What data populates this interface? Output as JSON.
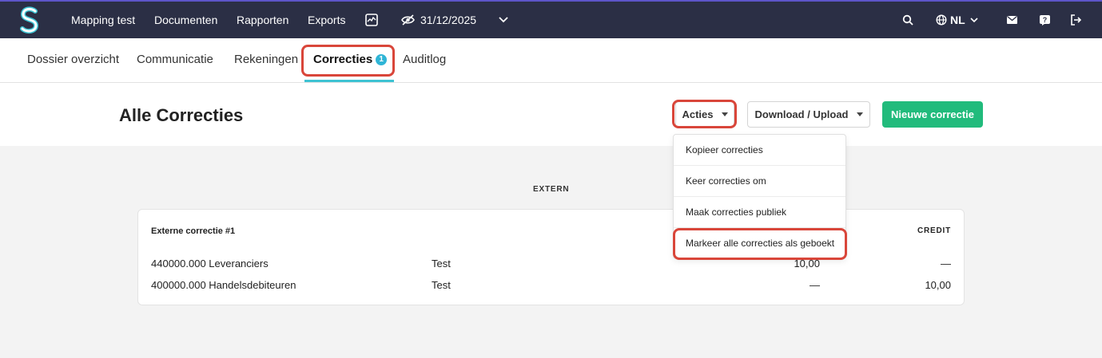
{
  "topbar": {
    "logo": "S",
    "nav": [
      "Mapping test",
      "Documenten",
      "Rapporten",
      "Exports"
    ],
    "date": "31/12/2025",
    "language": "NL",
    "icons": [
      "chart-icon",
      "eye-off-icon",
      "chevron-down-icon",
      "search-icon",
      "globe-icon",
      "mail-icon",
      "help-icon",
      "logout-icon"
    ]
  },
  "tabs": [
    {
      "label": "Dossier overzicht"
    },
    {
      "label": "Communicatie"
    },
    {
      "label": "Rekeningen"
    },
    {
      "label": "Correcties",
      "badge": "1",
      "active": true
    },
    {
      "label": "Auditlog"
    }
  ],
  "header": {
    "title": "Alle Correcties",
    "actions_label": "Acties",
    "download_label": "Download / Upload",
    "new_label": "Nieuwe correctie"
  },
  "dropdown": {
    "items": [
      "Kopieer correcties",
      "Keer correcties om",
      "Maak correcties publiek",
      "Markeer alle correcties als geboekt"
    ]
  },
  "content": {
    "section_label": "EXTERN",
    "card": {
      "title": "Externe correctie #1",
      "credit_header": "CREDIT",
      "rows": [
        {
          "account": "440000.000 Leveranciers",
          "description": "Test",
          "debit": "10,00",
          "credit": "—"
        },
        {
          "account": "400000.000 Handelsdebiteuren",
          "description": "Test",
          "debit": "—",
          "credit": "10,00"
        }
      ]
    }
  },
  "colors": {
    "topbar": "#2b2f45",
    "accent": "#3ec3d3",
    "primary": "#21bb7c",
    "highlight": "#d9463a",
    "badge": "#2fb5d6"
  }
}
